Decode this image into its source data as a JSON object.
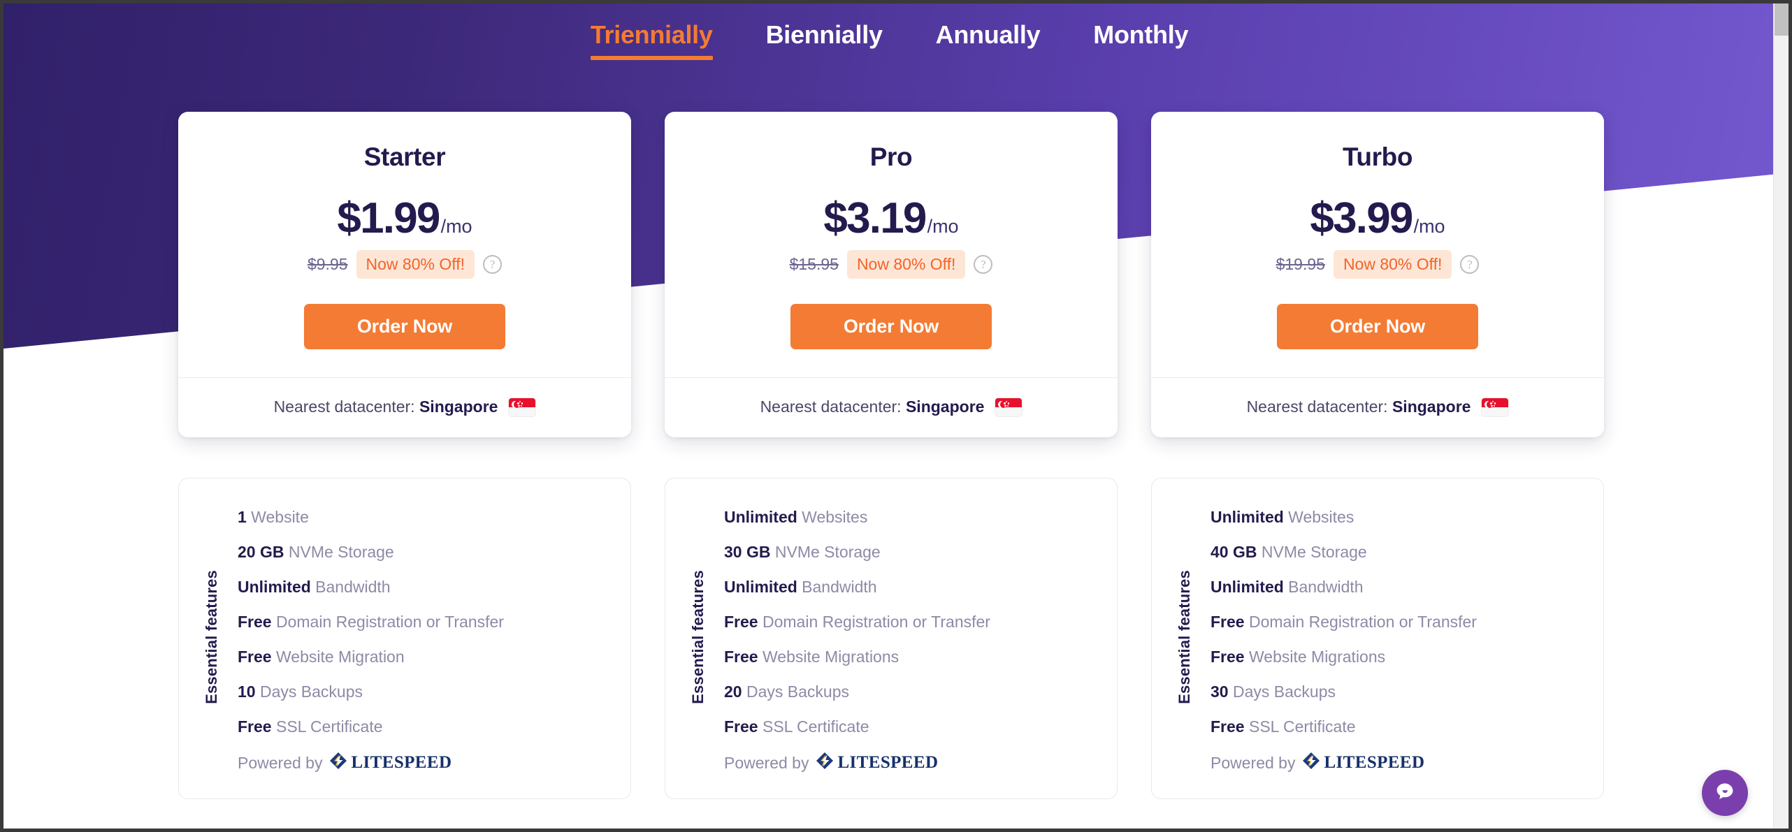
{
  "theme": {
    "accent_orange": "#f47b33",
    "purple_dark": "#31206a",
    "purple_light": "#7458cf",
    "navy_text": "#241a4d",
    "muted_text": "#8d8aa6",
    "badge_bg": "#fde6d6"
  },
  "billing_cycles": [
    {
      "label": "Triennially",
      "active": true
    },
    {
      "label": "Biennially",
      "active": false
    },
    {
      "label": "Annually",
      "active": false
    },
    {
      "label": "Monthly",
      "active": false
    }
  ],
  "datacenter": {
    "prefix": "Nearest datacenter:",
    "city": "Singapore",
    "flag": "singapore-flag"
  },
  "features_axis_label": "Essential features",
  "powered_by_label": "Powered by",
  "powered_by_brand": "LITESPEED",
  "order_label": "Order Now",
  "help_icon_glyph": "?",
  "plans": [
    {
      "name": "Starter",
      "price": "$1.99",
      "period": "/mo",
      "old_price": "$9.95",
      "discount": "Now 80% Off!",
      "features": [
        {
          "strong": "1",
          "rest": " Website"
        },
        {
          "strong": "20 GB",
          "rest": " NVMe Storage"
        },
        {
          "strong": "Unlimited",
          "rest": " Bandwidth"
        },
        {
          "strong": "Free",
          "rest": " Domain Registration or Transfer"
        },
        {
          "strong": "Free",
          "rest": " Website Migration"
        },
        {
          "strong": "10",
          "rest": " Days Backups"
        },
        {
          "strong": "Free",
          "rest": " SSL Certificate"
        }
      ]
    },
    {
      "name": "Pro",
      "price": "$3.19",
      "period": "/mo",
      "old_price": "$15.95",
      "discount": "Now 80% Off!",
      "features": [
        {
          "strong": "Unlimited",
          "rest": " Websites"
        },
        {
          "strong": "30 GB",
          "rest": " NVMe Storage"
        },
        {
          "strong": "Unlimited",
          "rest": " Bandwidth"
        },
        {
          "strong": "Free",
          "rest": " Domain Registration or Transfer"
        },
        {
          "strong": "Free",
          "rest": " Website Migrations"
        },
        {
          "strong": "20",
          "rest": " Days Backups"
        },
        {
          "strong": "Free",
          "rest": " SSL Certificate"
        }
      ]
    },
    {
      "name": "Turbo",
      "price": "$3.99",
      "period": "/mo",
      "old_price": "$19.95",
      "discount": "Now 80% Off!",
      "features": [
        {
          "strong": "Unlimited",
          "rest": " Websites"
        },
        {
          "strong": "40 GB",
          "rest": " NVMe Storage"
        },
        {
          "strong": "Unlimited",
          "rest": " Bandwidth"
        },
        {
          "strong": "Free",
          "rest": " Domain Registration or Transfer"
        },
        {
          "strong": "Free",
          "rest": " Website Migrations"
        },
        {
          "strong": "30",
          "rest": " Days Backups"
        },
        {
          "strong": "Free",
          "rest": " SSL Certificate"
        }
      ]
    }
  ],
  "chat_widget": {
    "icon": "chat-bubble-icon"
  }
}
